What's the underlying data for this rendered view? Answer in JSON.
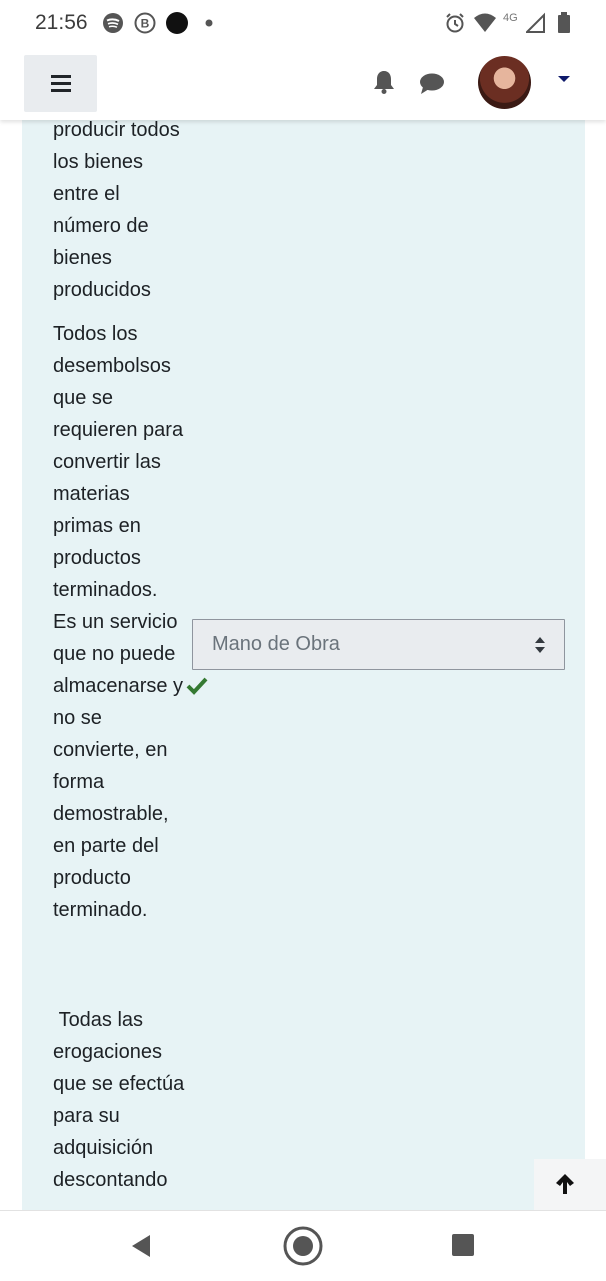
{
  "status_bar": {
    "time": "21:56",
    "network": "4G",
    "icons": [
      "spotify-icon",
      "b-icon",
      "dot-icon",
      "alarm-icon",
      "wifi-icon",
      "signal-icon",
      "battery-icon"
    ]
  },
  "navbar": {
    "menu_icon": "hamburger-icon",
    "notification_icon": "bell-icon",
    "message_icon": "chat-icon",
    "user_menu_icon": "caret-down-icon"
  },
  "question": {
    "fragment_1": "producir todos los bienes entre el número de bienes producidos",
    "fragment_2": "Todos los desembolsos que se requieren para convertir las materias primas en productos terminados. Es un servicio que no puede almacenarse y no se convierte, en forma demostrable, en parte del producto terminado.",
    "fragment_3": " Todas las erogaciones que se efectúa para su adquisición descontando",
    "select_value": "Mano de Obra",
    "answer_state": "correct"
  },
  "colors": {
    "panel_bg": "#e7f3f5",
    "check": "#357a32",
    "select_bg": "#e9ecef"
  },
  "android_nav": [
    "back-icon",
    "home-icon",
    "recents-icon"
  ]
}
